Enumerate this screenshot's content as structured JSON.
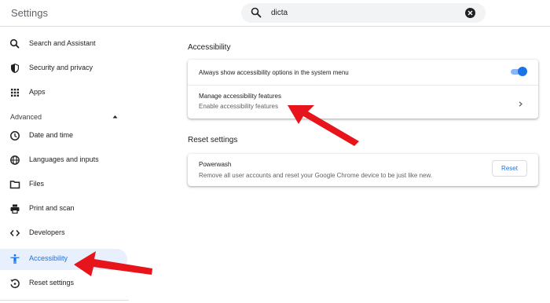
{
  "header": {
    "title": "Settings",
    "search_value": "dicta",
    "search_icon": "search-icon",
    "clear_icon": "close-icon"
  },
  "sidebar": {
    "items": [
      {
        "label": "Search and Assistant",
        "icon": "search-icon"
      },
      {
        "label": "Security and privacy",
        "icon": "shield-icon"
      },
      {
        "label": "Apps",
        "icon": "apps-grid-icon"
      }
    ],
    "advanced_label": "Advanced",
    "advanced_items": [
      {
        "label": "Date and time",
        "icon": "clock-icon"
      },
      {
        "label": "Languages and inputs",
        "icon": "globe-icon"
      },
      {
        "label": "Files",
        "icon": "folder-icon"
      },
      {
        "label": "Print and scan",
        "icon": "printer-icon"
      },
      {
        "label": "Developers",
        "icon": "code-icon"
      },
      {
        "label": "Accessibility",
        "icon": "accessibility-icon",
        "active": true
      },
      {
        "label": "Reset settings",
        "icon": "reset-icon"
      }
    ]
  },
  "main": {
    "accessibility": {
      "title": "Accessibility",
      "always_show_label": "Always show accessibility options in the system menu",
      "always_show_on": true,
      "manage_title": "Manage accessibility features",
      "manage_subtitle": "Enable accessibility features"
    },
    "reset": {
      "title": "Reset settings",
      "powerwash_title": "Powerwash",
      "powerwash_desc": "Remove all user accounts and reset your Google Chrome device to be just like new.",
      "button_label": "Reset"
    }
  },
  "colors": {
    "accent": "#1a73e8",
    "active_bg": "#e8f0fe",
    "annotation_arrow": "#e8141b"
  }
}
